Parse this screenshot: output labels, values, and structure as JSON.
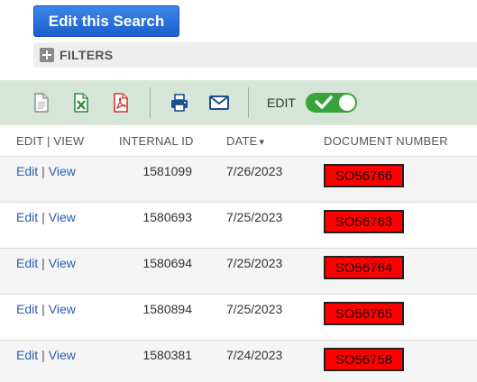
{
  "search": {
    "edit_button_label": "Edit this Search"
  },
  "filters": {
    "label": "FILTERS",
    "toggle_icon": "plus-square-icon"
  },
  "toolbar": {
    "icons": [
      "document-icon",
      "excel-icon",
      "pdf-icon",
      "print-icon",
      "email-icon"
    ],
    "edit_label": "EDIT",
    "edit_toggle_on": true,
    "accent_color": "#37a33b",
    "background_color": "#d5e6d8"
  },
  "table": {
    "columns": {
      "edit_view": "EDIT | VIEW",
      "internal_id": "INTERNAL ID",
      "date": "DATE",
      "date_sort_icon": "▾",
      "document_number": "DOCUMENT NUMBER"
    },
    "rows": [
      {
        "edit": "Edit",
        "sep": "|",
        "view": "View",
        "internal_id": "1581099",
        "date": "7/26/2023",
        "document_number": "SO56766"
      },
      {
        "edit": "Edit",
        "sep": "|",
        "view": "View",
        "internal_id": "1580693",
        "date": "7/25/2023",
        "document_number": "SO56763"
      },
      {
        "edit": "Edit",
        "sep": "|",
        "view": "View",
        "internal_id": "1580694",
        "date": "7/25/2023",
        "document_number": "SO56764"
      },
      {
        "edit": "Edit",
        "sep": "|",
        "view": "View",
        "internal_id": "1580894",
        "date": "7/25/2023",
        "document_number": "SO56765"
      },
      {
        "edit": "Edit",
        "sep": "|",
        "view": "View",
        "internal_id": "1580381",
        "date": "7/24/2023",
        "document_number": "SO56758"
      }
    ],
    "highlight_color": "#ff0000"
  }
}
